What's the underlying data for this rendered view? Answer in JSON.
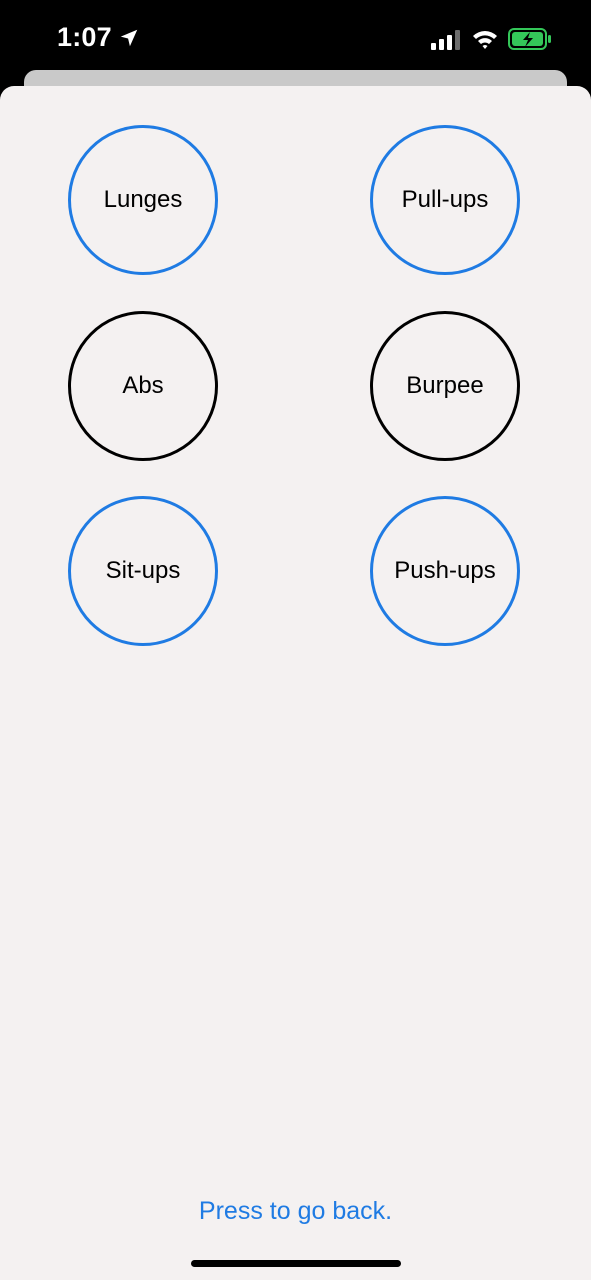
{
  "status_bar": {
    "time": "1:07",
    "battery_color": "#34c759"
  },
  "exercises": [
    {
      "label": "Lunges",
      "style": "blue"
    },
    {
      "label": "Pull-ups",
      "style": "blue"
    },
    {
      "label": "Abs",
      "style": "black"
    },
    {
      "label": "Burpee",
      "style": "black"
    },
    {
      "label": "Sit-ups",
      "style": "blue"
    },
    {
      "label": "Push-ups",
      "style": "blue"
    }
  ],
  "footer": {
    "back_label": "Press to go back."
  },
  "colors": {
    "accent": "#1f7be3",
    "sheet_background": "#f4f1f1"
  }
}
